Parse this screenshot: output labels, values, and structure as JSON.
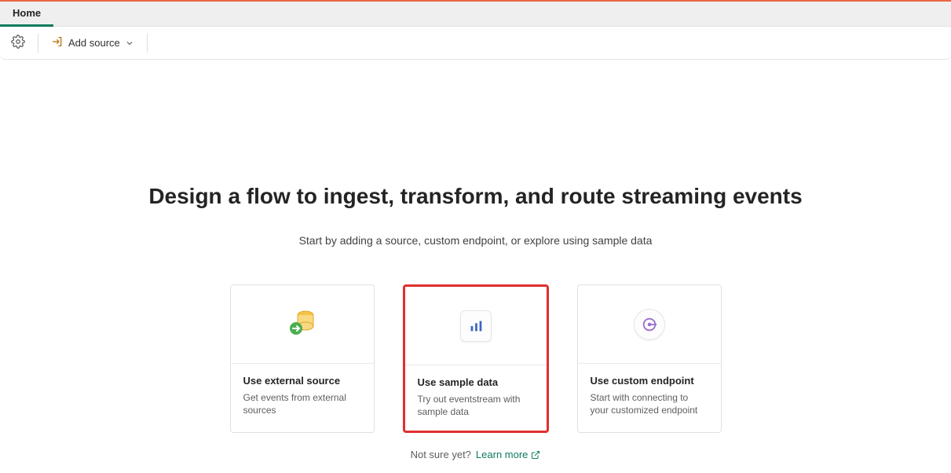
{
  "ribbon": {
    "tab": "Home",
    "add_source_label": "Add source"
  },
  "main": {
    "headline": "Design a flow to ingest, transform, and route streaming events",
    "subhead": "Start by adding a source, custom endpoint, or explore using sample data"
  },
  "cards": [
    {
      "title": "Use external source",
      "desc": "Get events from external sources",
      "icon": "database-arrow-icon",
      "highlight": false
    },
    {
      "title": "Use sample data",
      "desc": "Try out eventstream with sample data",
      "icon": "bar-chart-icon",
      "highlight": true
    },
    {
      "title": "Use custom endpoint",
      "desc": "Start with connecting to your customized endpoint",
      "icon": "endpoint-icon",
      "highlight": false
    }
  ],
  "footer": {
    "not_sure": "Not sure yet?",
    "learn_more": "Learn more"
  }
}
